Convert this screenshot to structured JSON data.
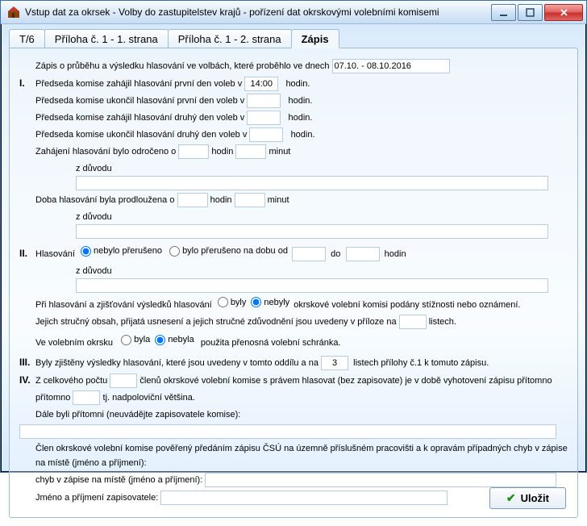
{
  "window": {
    "title": "Vstup dat za okrsek - Volby do zastupitelstev krajů - pořízení dat okrskovými volebními komisemi"
  },
  "tabs": [
    {
      "label": "T/6"
    },
    {
      "label": "Příloha č. 1 - 1. strana"
    },
    {
      "label": "Příloha č. 1 - 2. strana"
    },
    {
      "label": "Zápis",
      "active": true
    }
  ],
  "form": {
    "intro": "Zápis o průběhu a výsledku hlasování ve volbách, které proběhlo ve dnech",
    "dates": "07.10. - 08.10.2016",
    "sec1": {
      "num": "I.",
      "line1_a": "Předseda komise zahájil hlasování první den voleb v",
      "line1_time": "14:00",
      "line1_b": "hodin.",
      "line2_a": "Předseda komise ukončil hlasování první den voleb v",
      "line2_b": "hodin.",
      "line3_a": "Předseda komise zahájil hlasování druhý den voleb v",
      "line3_b": "hodin.",
      "line4_a": "Předseda komise ukončil hlasování druhý den voleb v",
      "line4_b": "hodin.",
      "delay_a": "Zahájení hlasování bylo odročeno o",
      "hours": "hodin",
      "minutes": "minut",
      "reason": "z důvodu",
      "extend_a": "Doba hlasování byla prodloužena o"
    },
    "sec2": {
      "num": "II.",
      "vote_label": "Hlasování",
      "opt_not_int": "nebylo přerušeno",
      "opt_int": "bylo přerušeno na dobu od",
      "to": "do",
      "hours": "hodin",
      "reason": "z důvodu",
      "complaints_a": "Při hlasování a zjišťování výsledků hlasování",
      "opt_were": "byly",
      "opt_werenot": "nebyly",
      "complaints_b": "okrskové volební komisi podány stížnosti nebo oznámení.",
      "complaints_c": "Jejich stručný obsah, přijatá usnesení a jejich stručné zdůvodnění jsou uvedeny v příloze na",
      "complaints_d": "listech.",
      "ballot_a": "Ve volebním okrsku",
      "opt_was": "byla",
      "opt_wasnot": "nebyla",
      "ballot_b": "použita přenosná volební schránka."
    },
    "sec3": {
      "num": "III.",
      "text_a": "Byly zjištěny výsledky hlasování, které jsou uvedeny v tomto oddílu a na",
      "pages": "3",
      "text_b": "listech přílohy č.1 k tomuto zápisu."
    },
    "sec4": {
      "num": "IV.",
      "text_a": "Z celkového počtu",
      "text_b": "členů okrskové volební komise s právem hlasovat (bez zapisovate) je v době vyhotovení zápisu přítomno",
      "text_c": "tj. nadpoloviční většina.",
      "present": "Dále byli přítomni (neuvádějte zapisovatele komise):",
      "deliver": "Člen okrskové volební komise pověřený předáním zápisu ČSÚ na územně příslušném pracovišti a k opravám případných chyb v zápise na místě (jméno a příjmení):",
      "recorder": "Jméno a příjmení zapisovatele:"
    },
    "save": "Uložit"
  }
}
